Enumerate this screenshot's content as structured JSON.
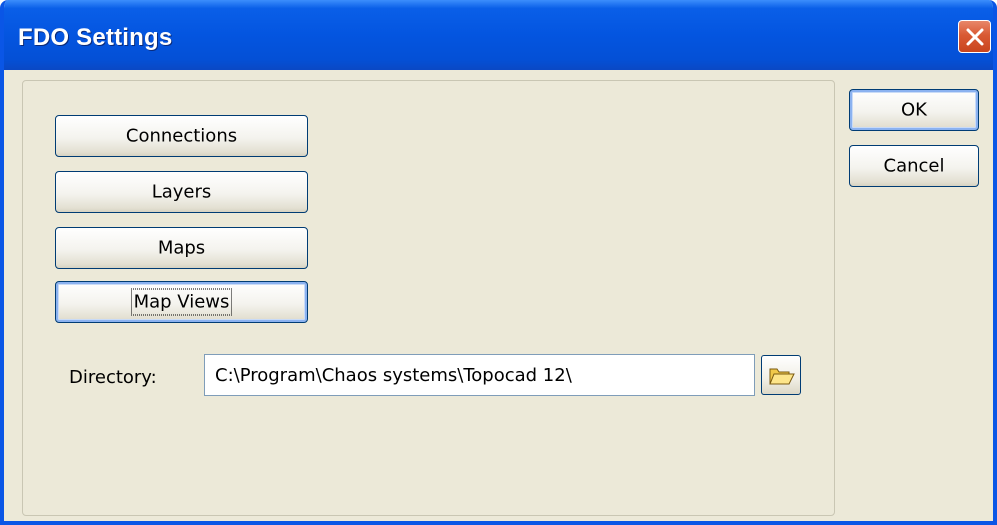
{
  "window": {
    "title": "FDO Settings",
    "close_icon": "close-icon"
  },
  "nav": {
    "connections_label": "Connections",
    "layers_label": "Layers",
    "maps_label": "Maps",
    "map_views_label": "Map Views"
  },
  "directory": {
    "label": "Directory:",
    "value": "C:\\Program\\Chaos systems\\Topocad 12\\",
    "browse_icon": "folder-open-icon"
  },
  "actions": {
    "ok_label": "OK",
    "cancel_label": "Cancel"
  },
  "colors": {
    "titlebar": "#0455e0",
    "window_bg": "#ece9d8",
    "close_button": "#d95a34",
    "button_border": "#003c74"
  }
}
